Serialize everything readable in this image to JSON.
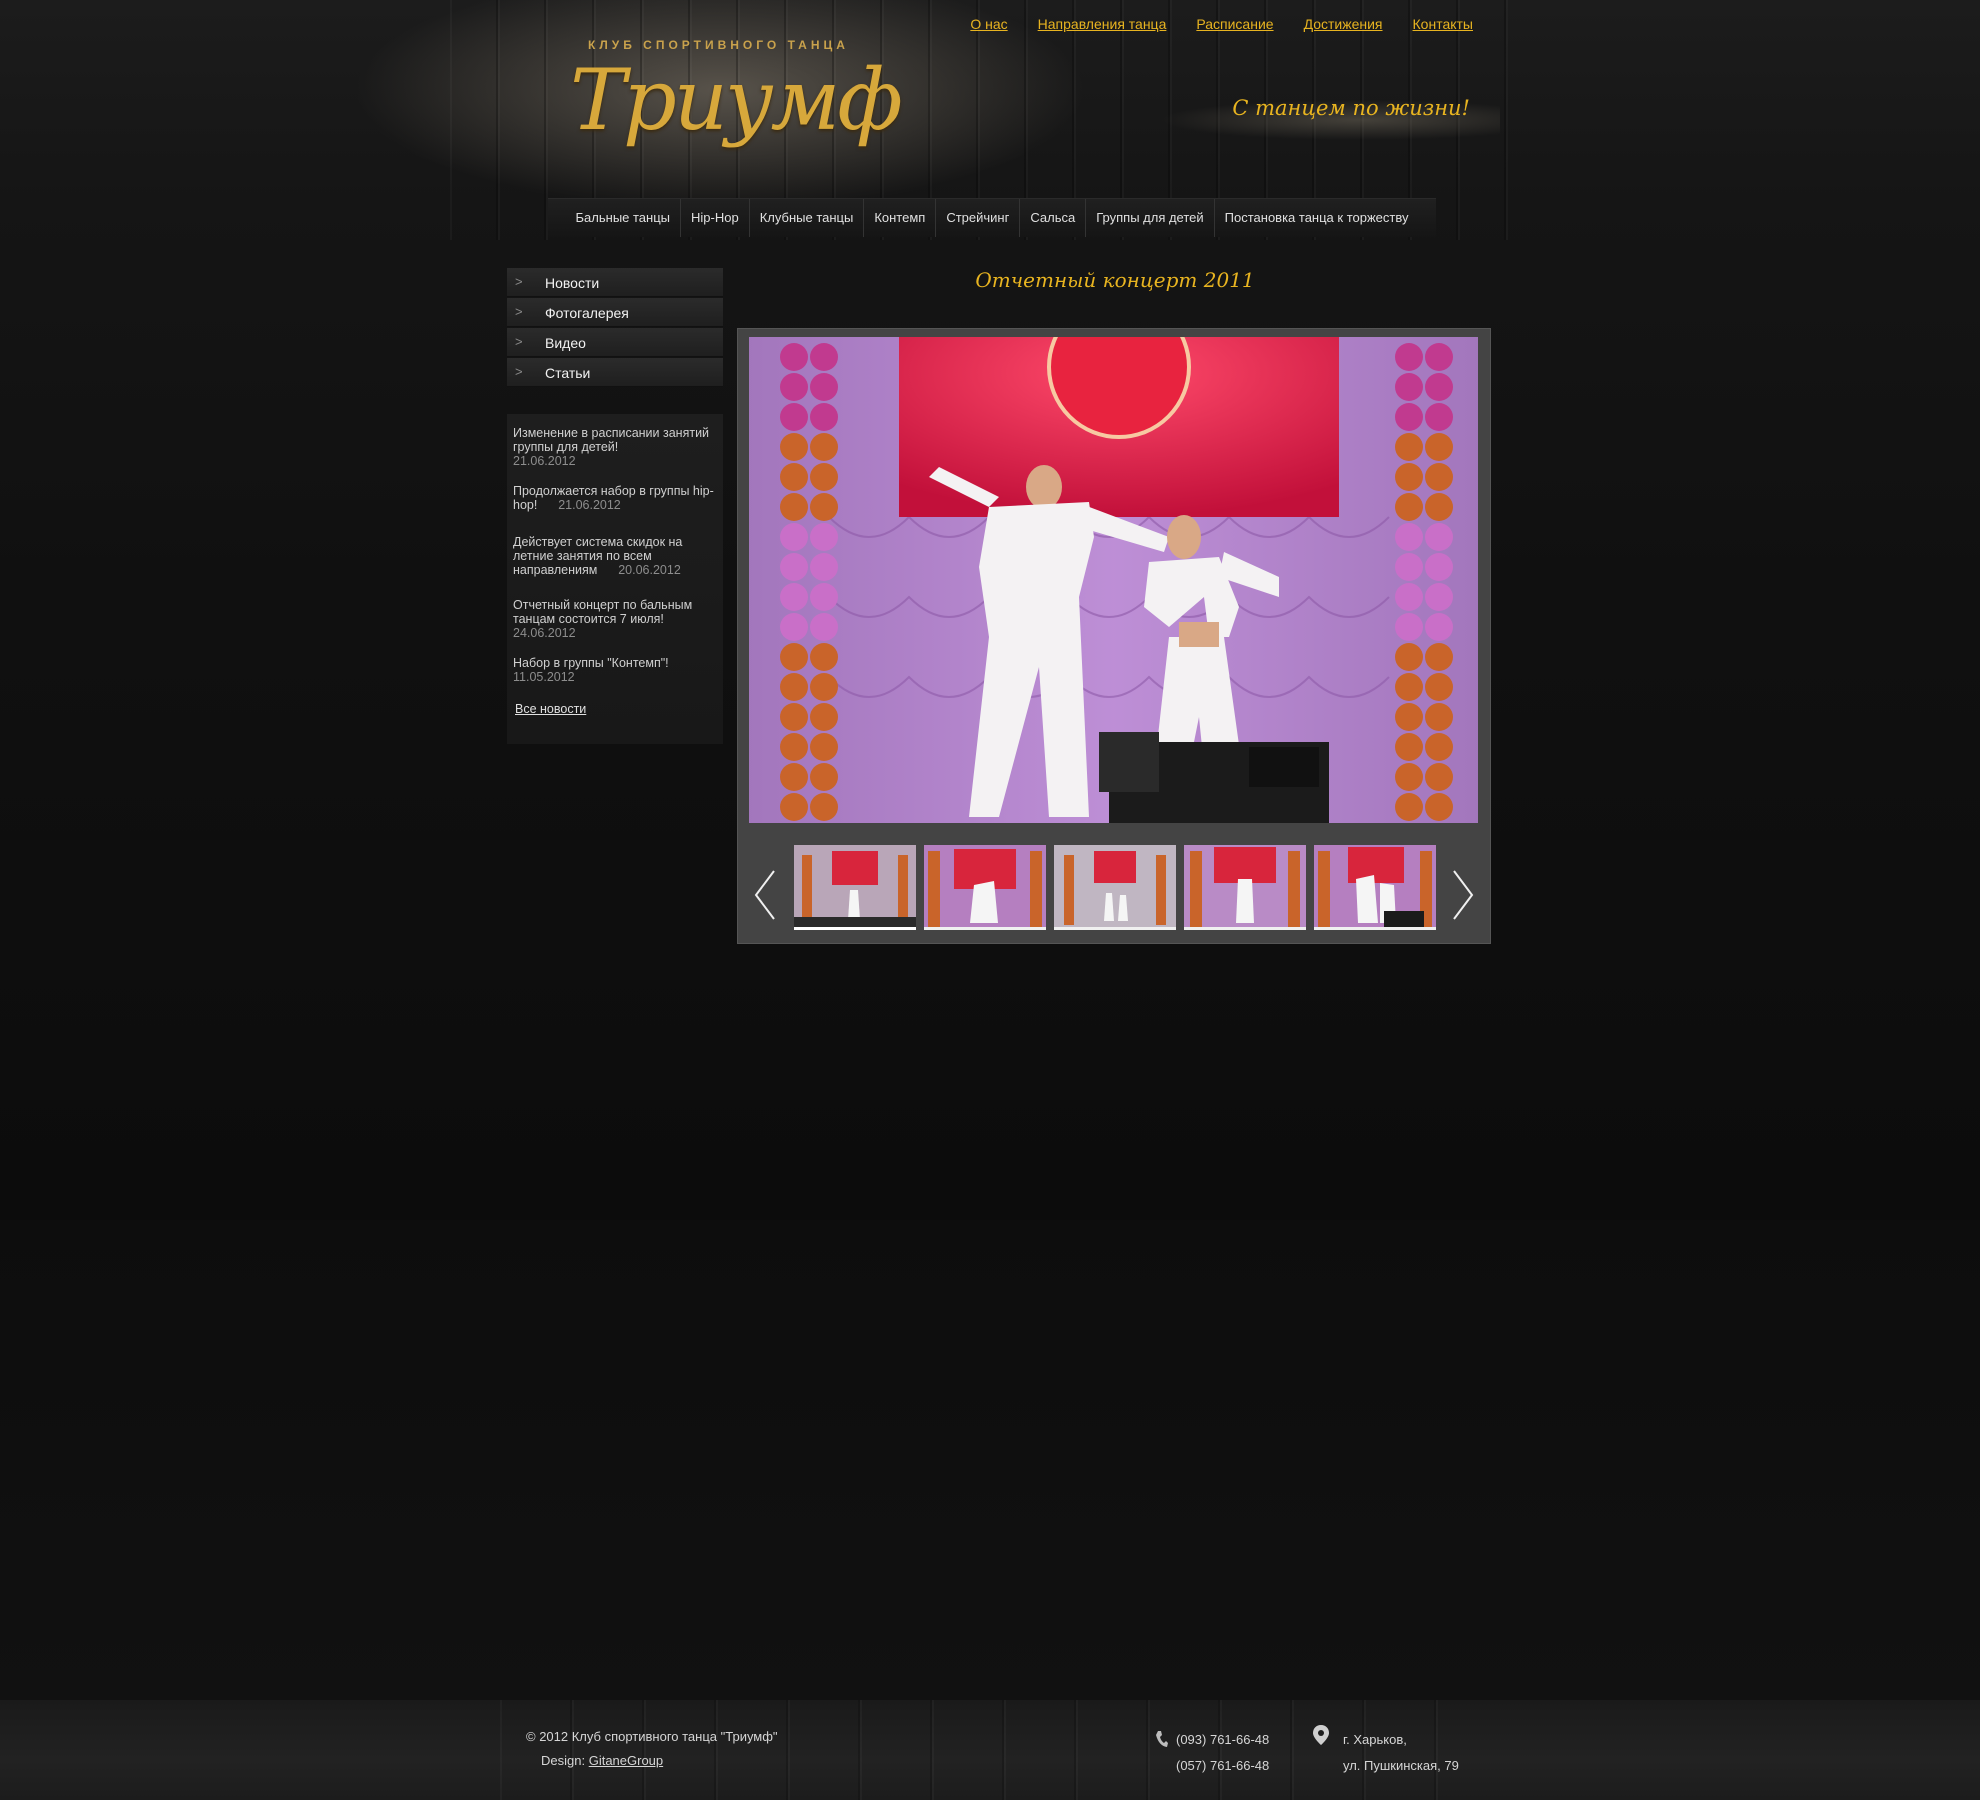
{
  "brand": {
    "logo_subtitle": "КЛУБ СПОРТИВНОГО ТАНЦА",
    "logo_name": "Триумф",
    "slogan": "С танцем по жизни!"
  },
  "top_links": [
    "О нас",
    "Направления танца",
    "Расписание",
    "Достижения",
    "Контакты"
  ],
  "main_nav": [
    "Бальные танцы",
    "Hip-Hop",
    "Клубные танцы",
    "Контемп",
    "Стрейчинг",
    "Сальса",
    "Группы для детей",
    "Постановка танца к торжеству"
  ],
  "side_menu": [
    "Новости",
    "Фотогалерея",
    "Видео",
    "Статьи"
  ],
  "news": {
    "items": [
      {
        "text": "Изменение в расписании занятий группы для детей!",
        "date": "21.06.2012"
      },
      {
        "text": "Продолжается набор в группы hip-hop!",
        "date": "21.06.2012"
      },
      {
        "text": "Действует система скидок на летние занятия по всем направлениям",
        "date": "20.06.2012"
      },
      {
        "text": "Отчетный концерт по бальным танцам состоится 7 июля!",
        "date": "24.06.2012"
      },
      {
        "text": "Набор в группы \"Контемп\"!",
        "date": "11.05.2012"
      }
    ],
    "all_label": "Все новости"
  },
  "gallery": {
    "title": "Отчетный концерт 2011",
    "thumb_count": 5,
    "active_thumb": 1
  },
  "footer": {
    "copyright": "©  2012 Клуб спортивного танца \"Триумф\"",
    "design_label": "Design:",
    "design_link": "GitaneGroup",
    "phone1": "(093) 761-66-48",
    "phone2": "(057) 761-66-48",
    "city": "г. Харьков,",
    "street": "ул. Пушкинская, 79"
  },
  "colors": {
    "accent": "#e8b420",
    "background": "#0e0e0e"
  }
}
